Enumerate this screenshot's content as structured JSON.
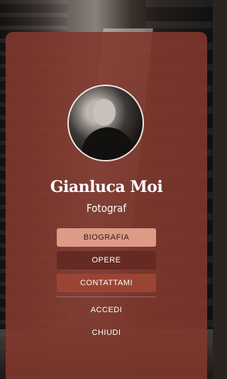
{
  "profile": {
    "name": "Gianluca Moi",
    "role": "Fotograf"
  },
  "menu": {
    "items": [
      {
        "label": "BIOGRAFIA",
        "active": true
      },
      {
        "label": "OPERE",
        "active": false
      },
      {
        "label": "CONTATTAMI",
        "active": false
      }
    ],
    "accedi_label": "ACCEDI",
    "chiudi_label": "CHIUDI"
  },
  "colors": {
    "panel": "#80372D",
    "biografia_button": "#DC9A87",
    "opere_button": "#652A23",
    "contattami_button": "#9A4434"
  }
}
